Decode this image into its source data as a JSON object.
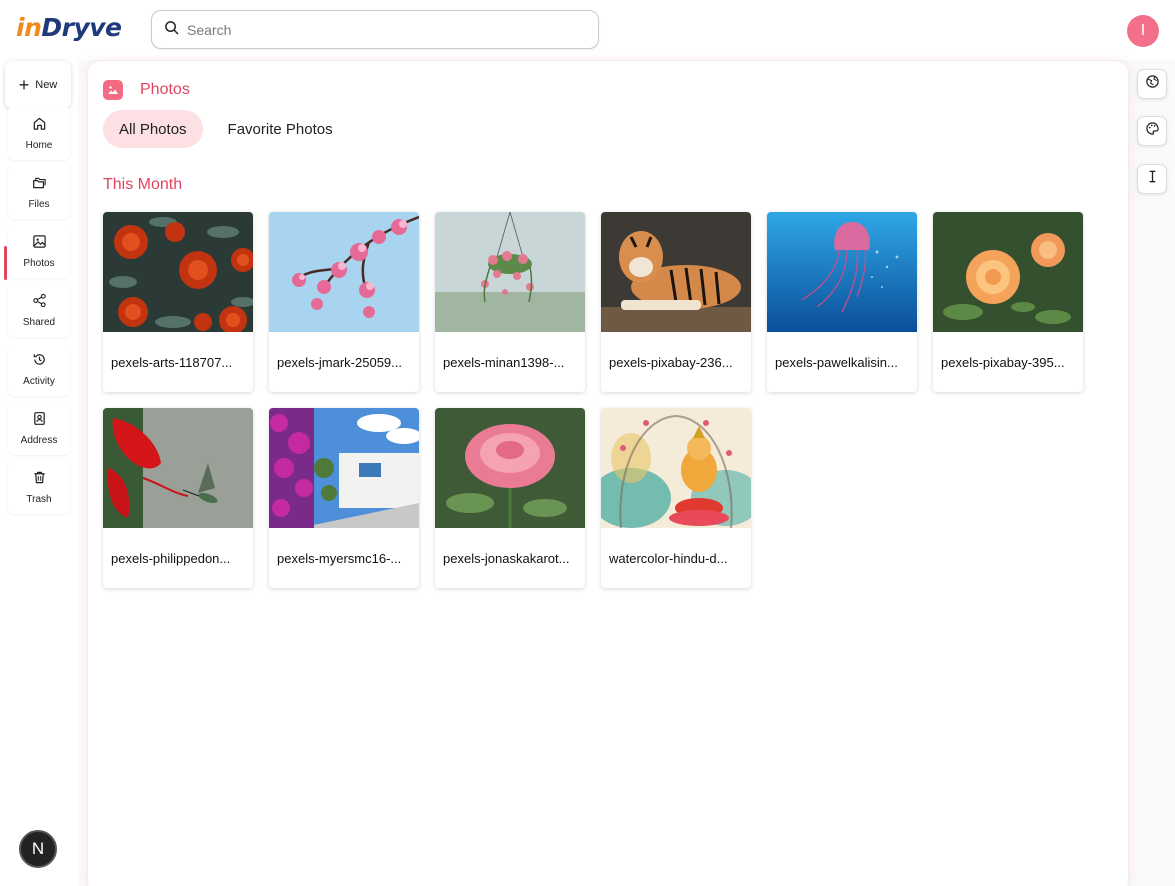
{
  "app": {
    "logo_part1": "in",
    "logo_part2": "Dryve",
    "avatar_initial": "I",
    "bottom_badge": "N"
  },
  "search": {
    "placeholder": "Search"
  },
  "sidebar": {
    "new_label": "New",
    "items": [
      {
        "label": "Home",
        "icon": "home-icon"
      },
      {
        "label": "Files",
        "icon": "files-icon"
      },
      {
        "label": "Photos",
        "icon": "photos-icon",
        "active": true
      },
      {
        "label": "Shared",
        "icon": "share-icon"
      },
      {
        "label": "Activity",
        "icon": "history-icon"
      },
      {
        "label": "Address",
        "icon": "address-book-icon"
      },
      {
        "label": "Trash",
        "icon": "trash-icon"
      }
    ]
  },
  "main": {
    "title": "Photos",
    "tabs": [
      {
        "label": "All Photos",
        "active": true
      },
      {
        "label": "Favorite Photos"
      }
    ],
    "section": "This Month",
    "photos": [
      {
        "name": "pexels-arts-118707..."
      },
      {
        "name": "pexels-jmark-25059..."
      },
      {
        "name": "pexels-minan1398-..."
      },
      {
        "name": "pexels-pixabay-236..."
      },
      {
        "name": "pexels-pawelkalisin..."
      },
      {
        "name": "pexels-pixabay-395..."
      },
      {
        "name": "pexels-philippedon..."
      },
      {
        "name": "pexels-myersmc16-..."
      },
      {
        "name": "pexels-jonaskakarot..."
      },
      {
        "name": "watercolor-hindu-d..."
      }
    ]
  },
  "right_rail": [
    {
      "icon": "globe-icon"
    },
    {
      "icon": "palette-icon"
    },
    {
      "icon": "text-cursor-icon"
    }
  ],
  "colors": {
    "accent": "#e0455f",
    "tab_active_bg": "#fde0e4",
    "avatar": "#f2708a"
  }
}
